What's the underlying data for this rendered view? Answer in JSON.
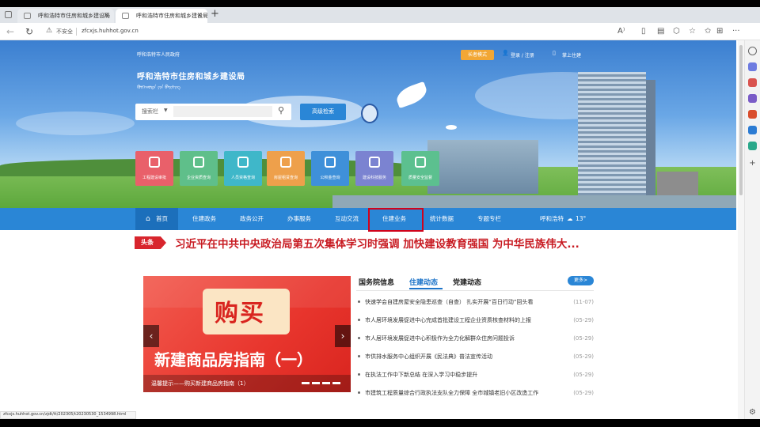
{
  "browser": {
    "tabs": [
      {
        "label": "呼和浩特市住房和城乡建设局",
        "active": false
      },
      {
        "label": "呼和浩特市住房和城乡建设局",
        "active": true
      }
    ],
    "security_label": "不安全",
    "url": "zfcxjs.huhhot.gov.cn"
  },
  "banner": {
    "gov_name": "呼和浩特市人民政府",
    "site_title": "呼和浩特市住房和城乡建设局",
    "site_title_mongolian": "ᠬᠥᠬᠡᠬᠣᠲᠠ ᠶᠢᠨ ᠪᠠᠢᠰᠢᠩ",
    "search_scope": "搜索栏",
    "advanced_search": "高级检索",
    "accessibility": "长者模式",
    "login": "登录 / 注册",
    "mobile": "掌上住建"
  },
  "tiles": [
    {
      "label": "工程建设审批",
      "color": "#e9606a"
    },
    {
      "label": "企业资质查询",
      "color": "#5fbf8a"
    },
    {
      "label": "人员资格查询",
      "color": "#3fb7c9"
    },
    {
      "label": "房屋租赁查询",
      "color": "#eea04b"
    },
    {
      "label": "公积金查询",
      "color": "#3f90d9"
    },
    {
      "label": "建设科技服务",
      "color": "#7b83d1"
    },
    {
      "label": "质量安全监督",
      "color": "#5cc08f"
    }
  ],
  "nav": {
    "items": [
      "首页",
      "住建政务",
      "政务公开",
      "办事服务",
      "互动交流",
      "住建业务",
      "统计数据",
      "专题专栏"
    ],
    "highlighted": "住建业务",
    "city": "呼和浩特",
    "temp": "13°"
  },
  "headline": {
    "badge": "头条",
    "text": "习近平在中共中央政治局第五次集体学习时强调 加快建设教育强国 为中华民族伟大..."
  },
  "carousel": {
    "big1": "购买",
    "big2": "新建商品房指南（一）",
    "caption": "温馨提示——购买新建商品房指南（1）"
  },
  "news": {
    "tabs": [
      "国务院信息",
      "住建动态",
      "党建动态"
    ],
    "active_tab": "住建动态",
    "more": "更多>",
    "items": [
      {
        "title": "快速学会自建房屋安全隐患巡查（自查） 扎实开展“百日行动”回头看",
        "date": "(11-07)"
      },
      {
        "title": "市人居环境发展促进中心完成首批建设工程企业资质核查材料的上报",
        "date": "(05-29)"
      },
      {
        "title": "市人居环境发展促进中心积极作为全力化解群众住房问题投诉",
        "date": "(05-29)"
      },
      {
        "title": "市供排水服务中心组织开展《民法典》普法宣传活动",
        "date": "(05-29)"
      },
      {
        "title": "在执法工作中下新总结 在深入学习中稳步提升",
        "date": "(05-29)"
      },
      {
        "title": "市建筑工程质量综合行政执法支队全力保障 全市城镇老旧小区改造工作",
        "date": "(05-29)"
      }
    ]
  },
  "status_url": "zfcxjs.huhhot.gov.cn/zjdt/tt/202305/t20230530_1534998.html"
}
